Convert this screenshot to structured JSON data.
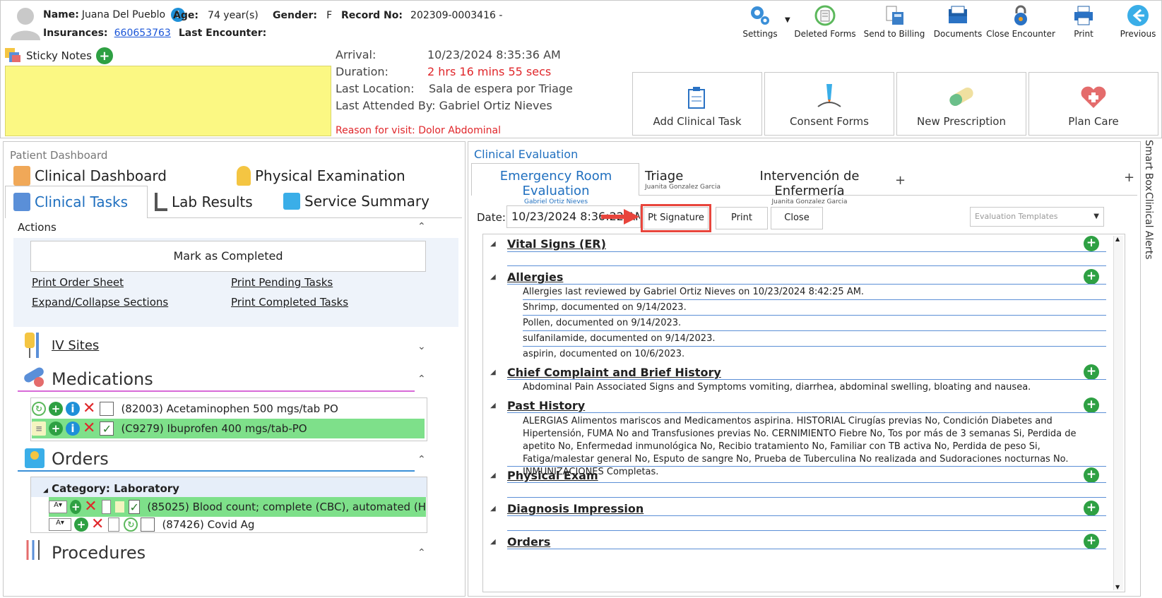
{
  "patient": {
    "name_label": "Name:",
    "name": "Juana Del Pueblo",
    "age_label": "Age:",
    "age": "74 year(s)",
    "gender_label": "Gender:",
    "gender": "F",
    "record_label": "Record No:",
    "record": "202309-0003416 -",
    "insurances_label": "Insurances:",
    "insurance": "660653763",
    "last_encounter_label": "Last Encounter:"
  },
  "toolbar": {
    "items": [
      {
        "label": "Settings"
      },
      {
        "label": "Deleted Forms"
      },
      {
        "label": "Send to Billing"
      },
      {
        "label": "Documents"
      },
      {
        "label": "Close Encounter"
      },
      {
        "label": "Print"
      },
      {
        "label": "Previous"
      }
    ]
  },
  "sticky": {
    "label": "Sticky Notes"
  },
  "visit": {
    "arrival_label": "Arrival:",
    "arrival": "10/23/2024 8:35:36 AM",
    "duration_label": "Duration:",
    "duration": "2 hrs 16 mins 55 secs",
    "location_label": "Last Location:",
    "location": "Sala de espera por Triage",
    "attended": "Last Attended By: Gabriel Ortiz Nieves",
    "reason": "Reason for visit: Dolor Abdominal"
  },
  "quick_actions": [
    {
      "label": "Add Clinical Task"
    },
    {
      "label": "Consent Forms"
    },
    {
      "label": "New Prescription"
    },
    {
      "label": "Plan Care"
    }
  ],
  "left": {
    "title": "Patient Dashboard",
    "tabs": {
      "clinical_dashboard": "Clinical Dashboard",
      "physical_exam": "Physical Examination",
      "clinical_tasks": "Clinical Tasks",
      "lab_results": "Lab Results",
      "service_summary": "Service Summary"
    },
    "actions_title": "Actions",
    "mark_completed": "Mark as Completed",
    "links": {
      "print_order": "Print Order Sheet",
      "print_pending": "Print Pending Tasks",
      "expand": "Expand/Collapse Sections",
      "print_completed": "Print Completed Tasks"
    },
    "iv_sites": "IV Sites",
    "medications": "Medications",
    "med_items": [
      {
        "text": "(82003) Acetaminophen 500 mgs/tab PO"
      },
      {
        "text": "(C9279) Ibuprofen 400 mgs/tab-PO"
      }
    ],
    "orders": "Orders",
    "order_category": "Category: Laboratory",
    "order_items": [
      {
        "text": "(85025) Blood count; complete (CBC), automated (H"
      },
      {
        "text": "(87426) Covid Ag"
      }
    ],
    "procedures": "Procedures"
  },
  "right": {
    "title": "Clinical Evaluation",
    "tabs": [
      {
        "label": "Emergency Room Evaluation",
        "sub": "Gabriel Ortiz Nieves"
      },
      {
        "label": "Triage",
        "sub": "Juanita Gonzalez Garcia"
      },
      {
        "label": "Intervención de Enfermería",
        "sub": "Juanita Gonzalez Garcia"
      }
    ],
    "date_label": "Date:",
    "date_value": "10/23/2024 8:36:22 AM",
    "pt_signature": "Pt Signature",
    "print": "Print",
    "close": "Close",
    "templates_placeholder": "Evaluation Templates",
    "sections": {
      "vitals": "Vital Signs (ER)",
      "allergies": "Allergies",
      "allergy_lines": [
        "Allergies last reviewed by Gabriel Ortiz Nieves on 10/23/2024 8:42:25 AM.",
        "Shrimp, documented on 9/14/2023.",
        "Pollen, documented on 9/14/2023.",
        "sulfanilamide, documented on 9/14/2023.",
        "aspirin, documented on 10/6/2023."
      ],
      "chief": "Chief Complaint and Brief History",
      "chief_text": "Abdominal Pain Associated Signs and Symptoms vomiting, diarrhea, abdominal swelling, bloating and nausea.",
      "past": "Past History",
      "past_text": "ALERGIAS Alimentos mariscos and Medicamentos aspirina. HISTORIAL Cirugías previas No, Condición Diabetes and Hipertensión, FUMA No and Transfusiones previas No. CERNIMIENTO Fiebre No, Tos por más de 3 semanas Si, Perdida de apetito No, Enfermedad inmunológica No, Recibio tratamiento No, Familiar con TB activa No, Perdida de peso Si, Fatiga/malestar general No, Esputo de sangre No, Prueba de Tuberculina No realizada and Sudoraciones nocturnas No. INMUNIZACIONES Completas.",
      "physical": "Physical Exam",
      "diagnosis": "Diagnosis Impression",
      "orders": "Orders"
    }
  },
  "side_tabs": {
    "smart_box": "Smart Box",
    "clinical_alerts": "Clinical Alerts"
  },
  "colors": {
    "accent": "#1f6fbf",
    "sticky": "#fbf883",
    "highlight_row": "#7ee08a",
    "red": "#e0262a"
  }
}
